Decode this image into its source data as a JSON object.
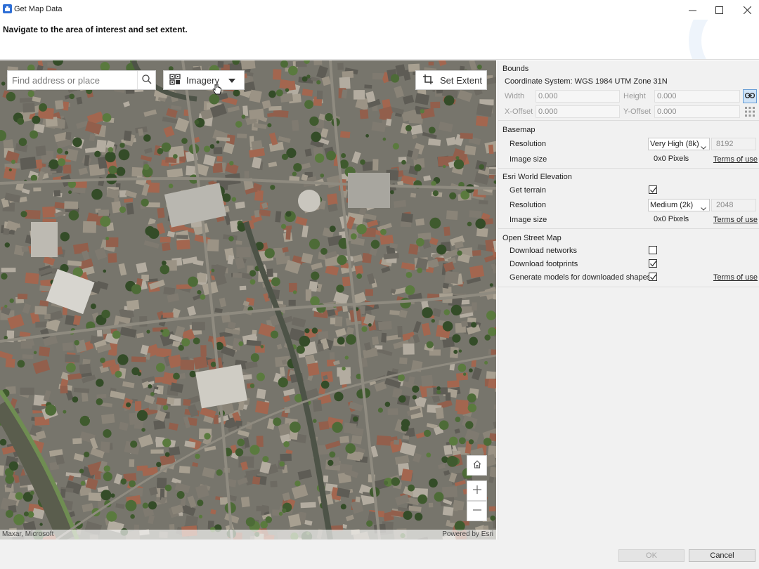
{
  "window": {
    "title": "Get Map Data",
    "instruction": "Navigate to the area of interest and set extent."
  },
  "map": {
    "search_placeholder": "Find address or place",
    "basemap_label": "Imagery",
    "set_extent_label": "Set Extent",
    "attribution_left": "Maxar, Microsoft",
    "attribution_right": "Powered by Esri"
  },
  "bounds": {
    "title": "Bounds",
    "coordinate_system": "Coordinate System: WGS 1984 UTM Zone 31N",
    "width_label": "Width",
    "width_value": "0.000",
    "height_label": "Height",
    "height_value": "0.000",
    "xoffset_label": "X-Offset",
    "xoffset_value": "0.000",
    "yoffset_label": "Y-Offset",
    "yoffset_value": "0.000"
  },
  "basemap": {
    "title": "Basemap",
    "resolution_label": "Resolution",
    "resolution_value": "Very High (8k)",
    "resolution_pixels": "8192",
    "image_size_label": "Image size",
    "image_size_value": "0x0 Pixels",
    "terms_label": "Terms of use"
  },
  "elevation": {
    "title": "Esri World Elevation",
    "get_terrain_label": "Get terrain",
    "get_terrain_checked": true,
    "resolution_label": "Resolution",
    "resolution_value": "Medium (2k)",
    "resolution_pixels": "2048",
    "image_size_label": "Image size",
    "image_size_value": "0x0 Pixels",
    "terms_label": "Terms of use"
  },
  "osm": {
    "title": "Open Street Map",
    "download_networks_label": "Download networks",
    "download_networks_checked": false,
    "download_footprints_label": "Download footprints",
    "download_footprints_checked": true,
    "generate_models_label": "Generate models for downloaded shapes",
    "generate_models_checked": true,
    "terms_label": "Terms of use"
  },
  "footer": {
    "ok_label": "OK",
    "cancel_label": "Cancel"
  },
  "colors": {
    "accent": "#2f6fd6",
    "panel_bg": "#f1f1f1",
    "link_toggle_bg": "#cfe3f7"
  }
}
